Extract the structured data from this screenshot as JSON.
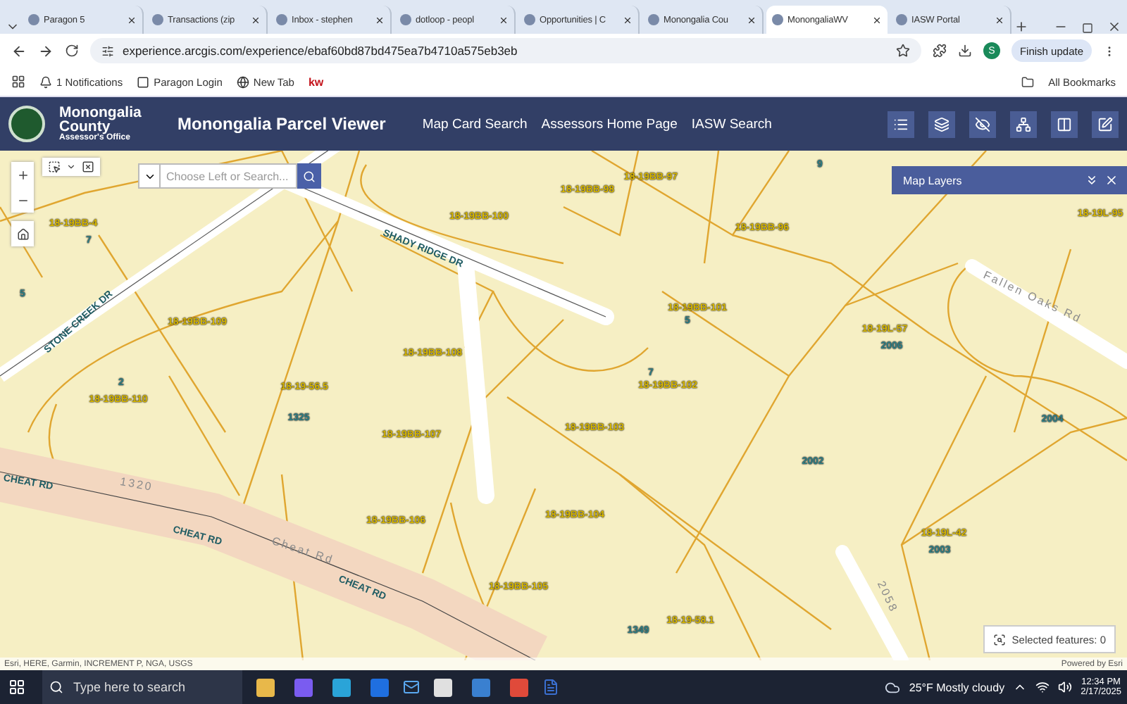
{
  "browser": {
    "tabs": [
      {
        "title": "Paragon 5",
        "selected": false
      },
      {
        "title": "Transactions (zip",
        "selected": false
      },
      {
        "title": "Inbox - stephen",
        "selected": false
      },
      {
        "title": "dotloop - peopl",
        "selected": false
      },
      {
        "title": "Opportunities | C",
        "selected": false
      },
      {
        "title": "Monongalia Cou",
        "selected": false
      },
      {
        "title": "MonongaliaWV",
        "selected": true
      },
      {
        "title": "IASW Portal",
        "selected": false
      }
    ],
    "url": "experience.arcgis.com/experience/ebaf60bd87bd475ea7b4710a575eb3eb",
    "profile_initial": "S",
    "update_button": "Finish update",
    "bookmarks": [
      {
        "label": "1 Notifications",
        "kind": "social"
      },
      {
        "label": "Paragon Login",
        "kind": "site"
      },
      {
        "label": "New Tab",
        "kind": "globe"
      },
      {
        "label": "kw",
        "kind": "logo"
      }
    ],
    "all_bookmarks": "All Bookmarks"
  },
  "header": {
    "org": "Monongalia County",
    "org_sub": "Assessor's Office",
    "title": "Monongalia Parcel Viewer",
    "nav": [
      "Map Card Search",
      "Assessors Home Page",
      "IASW Search"
    ]
  },
  "map": {
    "search_placeholder": "Choose Left or Search...",
    "panel_title": "Map Layers",
    "selected_features": "Selected features: 0",
    "attribution": "Esri, HERE, Garmin, INCREMENT P, NGA, USGS",
    "powered_by": "Powered by Esri",
    "labels": [
      {
        "text": "18-19BB-4",
        "kind": "parcel"
      },
      {
        "text": "7",
        "kind": "address"
      },
      {
        "text": "5",
        "kind": "address"
      },
      {
        "text": "18-19BB-100",
        "kind": "parcel"
      },
      {
        "text": "18-19BB-98",
        "kind": "parcel"
      },
      {
        "text": "18-19BB-97",
        "kind": "parcel"
      },
      {
        "text": "9",
        "kind": "address"
      },
      {
        "text": "18-19BB-96",
        "kind": "parcel"
      },
      {
        "text": "18-19L-95",
        "kind": "parcel"
      },
      {
        "text": "SHADY RIDGE DR",
        "kind": "road"
      },
      {
        "text": "STONE CREEK DR",
        "kind": "road"
      },
      {
        "text": "18-19BB-109",
        "kind": "parcel"
      },
      {
        "text": "18-19BB-108",
        "kind": "parcel"
      },
      {
        "text": "2",
        "kind": "address"
      },
      {
        "text": "18-19BB-110",
        "kind": "parcel"
      },
      {
        "text": "18-19-56.5",
        "kind": "parcel"
      },
      {
        "text": "1325",
        "kind": "address"
      },
      {
        "text": "18-19BB-107",
        "kind": "parcel"
      },
      {
        "text": "18-19BB-101",
        "kind": "parcel"
      },
      {
        "text": "5",
        "kind": "address"
      },
      {
        "text": "7",
        "kind": "address"
      },
      {
        "text": "18-19BB-102",
        "kind": "parcel"
      },
      {
        "text": "18-19L-57",
        "kind": "parcel"
      },
      {
        "text": "2006",
        "kind": "address"
      },
      {
        "text": "Fallen Oaks Rd",
        "kind": "street"
      },
      {
        "text": "2004",
        "kind": "address"
      },
      {
        "text": "18-19BB-103",
        "kind": "parcel"
      },
      {
        "text": "2002",
        "kind": "address"
      },
      {
        "text": "CHEAT RD",
        "kind": "road"
      },
      {
        "text": "1320",
        "kind": "street"
      },
      {
        "text": "CHEAT RD",
        "kind": "road"
      },
      {
        "text": "Cheat Rd",
        "kind": "street"
      },
      {
        "text": "CHEAT RD",
        "kind": "road"
      },
      {
        "text": "18-19BB-106",
        "kind": "parcel"
      },
      {
        "text": "18-19BB-104",
        "kind": "parcel"
      },
      {
        "text": "18-19BB-105",
        "kind": "parcel"
      },
      {
        "text": "18-19L-42",
        "kind": "parcel"
      },
      {
        "text": "2003",
        "kind": "address"
      },
      {
        "text": "2058",
        "kind": "street"
      },
      {
        "text": "18-19-58.1",
        "kind": "parcel"
      },
      {
        "text": "1349",
        "kind": "address"
      }
    ]
  },
  "taskbar": {
    "search_placeholder": "Type here to search",
    "weather": "25°F Mostly cloudy",
    "time": "12:34 PM",
    "date": "2/17/2025"
  }
}
